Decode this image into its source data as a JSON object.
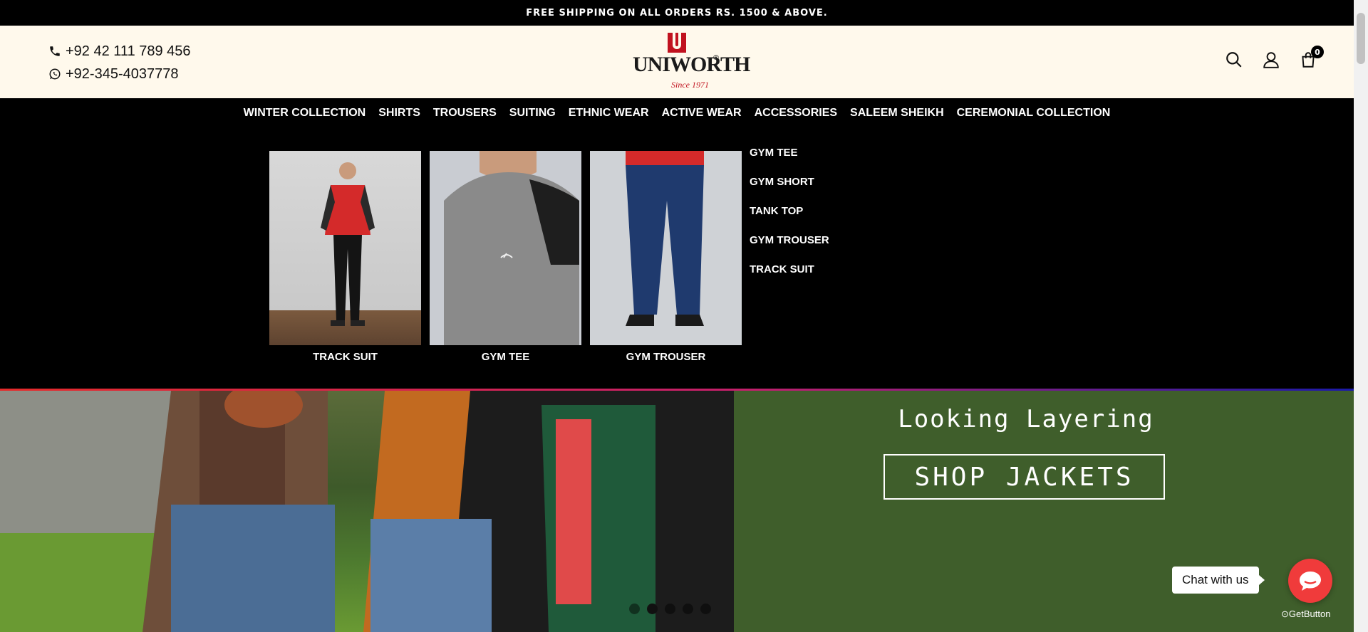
{
  "topbar": {
    "text": "FREE SHIPPING ON ALL ORDERS RS. 1500 & ABOVE."
  },
  "contact": {
    "phone": "+92 42 111 789 456",
    "whatsapp": "+92-345-4037778"
  },
  "logo": {
    "word": "UNIWORTH",
    "reg": "®",
    "since": "Since 1971",
    "brand_red": "#c1121f"
  },
  "header_icons": {
    "search": "search-icon",
    "account": "user-icon",
    "cart": "shopping-bag-icon",
    "cart_count": "0"
  },
  "nav": {
    "items": [
      "WINTER COLLECTION",
      "SHIRTS",
      "TROUSERS",
      "SUITING",
      "ETHNIC WEAR",
      "ACTIVE WEAR",
      "ACCESSORIES",
      "SALEEM SHEIKH",
      "CEREMONIAL COLLECTION"
    ]
  },
  "mega_menu": {
    "cards": [
      {
        "caption": "TRACK SUIT"
      },
      {
        "caption": "GYM TEE"
      },
      {
        "caption": "GYM TROUSER"
      }
    ],
    "links": [
      "GYM TEE",
      "GYM SHORT",
      "TANK TOP",
      "GYM TROUSER",
      "TRACK SUIT"
    ]
  },
  "hero": {
    "tagline": "Looking Layering",
    "cta": "SHOP JACKETS",
    "slides_total": 5,
    "active_slide": 2
  },
  "chat": {
    "label": "Chat with us",
    "powered_by": "GetButton",
    "color": "#f03b3b"
  }
}
